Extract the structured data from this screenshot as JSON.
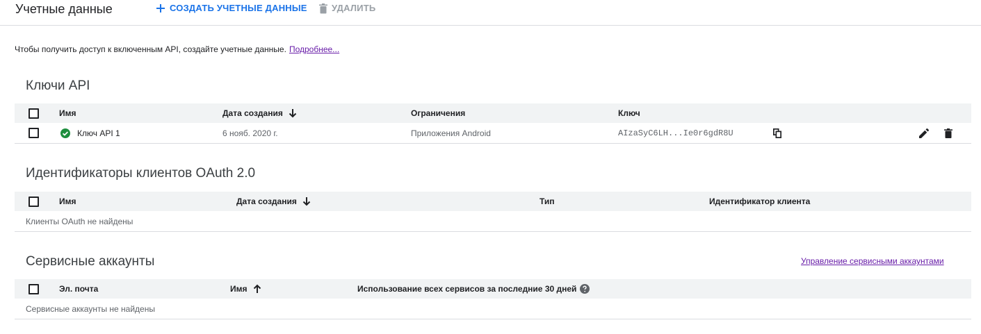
{
  "toolbar": {
    "title": "Учетные данные",
    "create_label": "СОЗДАТЬ УЧЕТНЫЕ ДАННЫЕ",
    "delete_label": "УДАЛИТЬ"
  },
  "intro": {
    "text": "Чтобы получить доступ к включенным API, создайте учетные данные.",
    "link": "Подробнее..."
  },
  "api_keys": {
    "title": "Ключи API",
    "columns": {
      "name": "Имя",
      "created": "Дата создания",
      "restrictions": "Ограничения",
      "key": "Ключ"
    },
    "rows": [
      {
        "name": "Ключ API 1",
        "created": "6 нояб. 2020 г.",
        "restrictions": "Приложения Android",
        "key": "AIzaSyC6LH...Ie0r6gdR8U",
        "status_icon": "check-circle-icon",
        "status_color": "#1e8e3e"
      }
    ]
  },
  "oauth": {
    "title": "Идентификаторы клиентов OAuth 2.0",
    "columns": {
      "name": "Имя",
      "created": "Дата создания",
      "type": "Тип",
      "client_id": "Идентификатор клиента"
    },
    "empty_text": "Клиенты OAuth не найдены"
  },
  "service_accounts": {
    "title": "Сервисные аккаунты",
    "manage_link": "Управление сервисными аккаунтами",
    "columns": {
      "email": "Эл. почта",
      "name": "Имя",
      "usage": "Использование всех сервисов за последние 30 дней"
    },
    "empty_text": "Сервисные аккаунты не найдены"
  },
  "colors": {
    "accent": "#1a73e8",
    "link": "#681da8",
    "header_bg": "#f1f3f4",
    "disabled": "#9aa0a6"
  }
}
